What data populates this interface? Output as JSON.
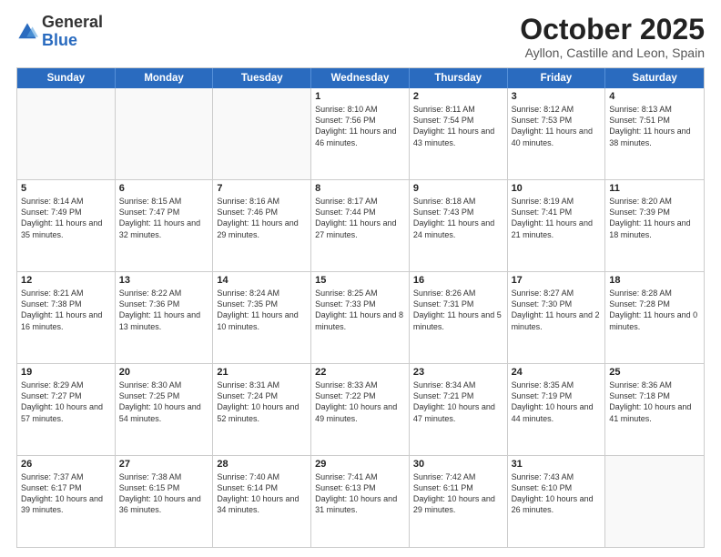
{
  "header": {
    "logo_general": "General",
    "logo_blue": "Blue",
    "month_title": "October 2025",
    "location": "Ayllon, Castille and Leon, Spain"
  },
  "days_of_week": [
    "Sunday",
    "Monday",
    "Tuesday",
    "Wednesday",
    "Thursday",
    "Friday",
    "Saturday"
  ],
  "weeks": [
    [
      {
        "day": "",
        "info": ""
      },
      {
        "day": "",
        "info": ""
      },
      {
        "day": "",
        "info": ""
      },
      {
        "day": "1",
        "info": "Sunrise: 8:10 AM\nSunset: 7:56 PM\nDaylight: 11 hours and 46 minutes."
      },
      {
        "day": "2",
        "info": "Sunrise: 8:11 AM\nSunset: 7:54 PM\nDaylight: 11 hours and 43 minutes."
      },
      {
        "day": "3",
        "info": "Sunrise: 8:12 AM\nSunset: 7:53 PM\nDaylight: 11 hours and 40 minutes."
      },
      {
        "day": "4",
        "info": "Sunrise: 8:13 AM\nSunset: 7:51 PM\nDaylight: 11 hours and 38 minutes."
      }
    ],
    [
      {
        "day": "5",
        "info": "Sunrise: 8:14 AM\nSunset: 7:49 PM\nDaylight: 11 hours and 35 minutes."
      },
      {
        "day": "6",
        "info": "Sunrise: 8:15 AM\nSunset: 7:47 PM\nDaylight: 11 hours and 32 minutes."
      },
      {
        "day": "7",
        "info": "Sunrise: 8:16 AM\nSunset: 7:46 PM\nDaylight: 11 hours and 29 minutes."
      },
      {
        "day": "8",
        "info": "Sunrise: 8:17 AM\nSunset: 7:44 PM\nDaylight: 11 hours and 27 minutes."
      },
      {
        "day": "9",
        "info": "Sunrise: 8:18 AM\nSunset: 7:43 PM\nDaylight: 11 hours and 24 minutes."
      },
      {
        "day": "10",
        "info": "Sunrise: 8:19 AM\nSunset: 7:41 PM\nDaylight: 11 hours and 21 minutes."
      },
      {
        "day": "11",
        "info": "Sunrise: 8:20 AM\nSunset: 7:39 PM\nDaylight: 11 hours and 18 minutes."
      }
    ],
    [
      {
        "day": "12",
        "info": "Sunrise: 8:21 AM\nSunset: 7:38 PM\nDaylight: 11 hours and 16 minutes."
      },
      {
        "day": "13",
        "info": "Sunrise: 8:22 AM\nSunset: 7:36 PM\nDaylight: 11 hours and 13 minutes."
      },
      {
        "day": "14",
        "info": "Sunrise: 8:24 AM\nSunset: 7:35 PM\nDaylight: 11 hours and 10 minutes."
      },
      {
        "day": "15",
        "info": "Sunrise: 8:25 AM\nSunset: 7:33 PM\nDaylight: 11 hours and 8 minutes."
      },
      {
        "day": "16",
        "info": "Sunrise: 8:26 AM\nSunset: 7:31 PM\nDaylight: 11 hours and 5 minutes."
      },
      {
        "day": "17",
        "info": "Sunrise: 8:27 AM\nSunset: 7:30 PM\nDaylight: 11 hours and 2 minutes."
      },
      {
        "day": "18",
        "info": "Sunrise: 8:28 AM\nSunset: 7:28 PM\nDaylight: 11 hours and 0 minutes."
      }
    ],
    [
      {
        "day": "19",
        "info": "Sunrise: 8:29 AM\nSunset: 7:27 PM\nDaylight: 10 hours and 57 minutes."
      },
      {
        "day": "20",
        "info": "Sunrise: 8:30 AM\nSunset: 7:25 PM\nDaylight: 10 hours and 54 minutes."
      },
      {
        "day": "21",
        "info": "Sunrise: 8:31 AM\nSunset: 7:24 PM\nDaylight: 10 hours and 52 minutes."
      },
      {
        "day": "22",
        "info": "Sunrise: 8:33 AM\nSunset: 7:22 PM\nDaylight: 10 hours and 49 minutes."
      },
      {
        "day": "23",
        "info": "Sunrise: 8:34 AM\nSunset: 7:21 PM\nDaylight: 10 hours and 47 minutes."
      },
      {
        "day": "24",
        "info": "Sunrise: 8:35 AM\nSunset: 7:19 PM\nDaylight: 10 hours and 44 minutes."
      },
      {
        "day": "25",
        "info": "Sunrise: 8:36 AM\nSunset: 7:18 PM\nDaylight: 10 hours and 41 minutes."
      }
    ],
    [
      {
        "day": "26",
        "info": "Sunrise: 7:37 AM\nSunset: 6:17 PM\nDaylight: 10 hours and 39 minutes."
      },
      {
        "day": "27",
        "info": "Sunrise: 7:38 AM\nSunset: 6:15 PM\nDaylight: 10 hours and 36 minutes."
      },
      {
        "day": "28",
        "info": "Sunrise: 7:40 AM\nSunset: 6:14 PM\nDaylight: 10 hours and 34 minutes."
      },
      {
        "day": "29",
        "info": "Sunrise: 7:41 AM\nSunset: 6:13 PM\nDaylight: 10 hours and 31 minutes."
      },
      {
        "day": "30",
        "info": "Sunrise: 7:42 AM\nSunset: 6:11 PM\nDaylight: 10 hours and 29 minutes."
      },
      {
        "day": "31",
        "info": "Sunrise: 7:43 AM\nSunset: 6:10 PM\nDaylight: 10 hours and 26 minutes."
      },
      {
        "day": "",
        "info": ""
      }
    ]
  ]
}
